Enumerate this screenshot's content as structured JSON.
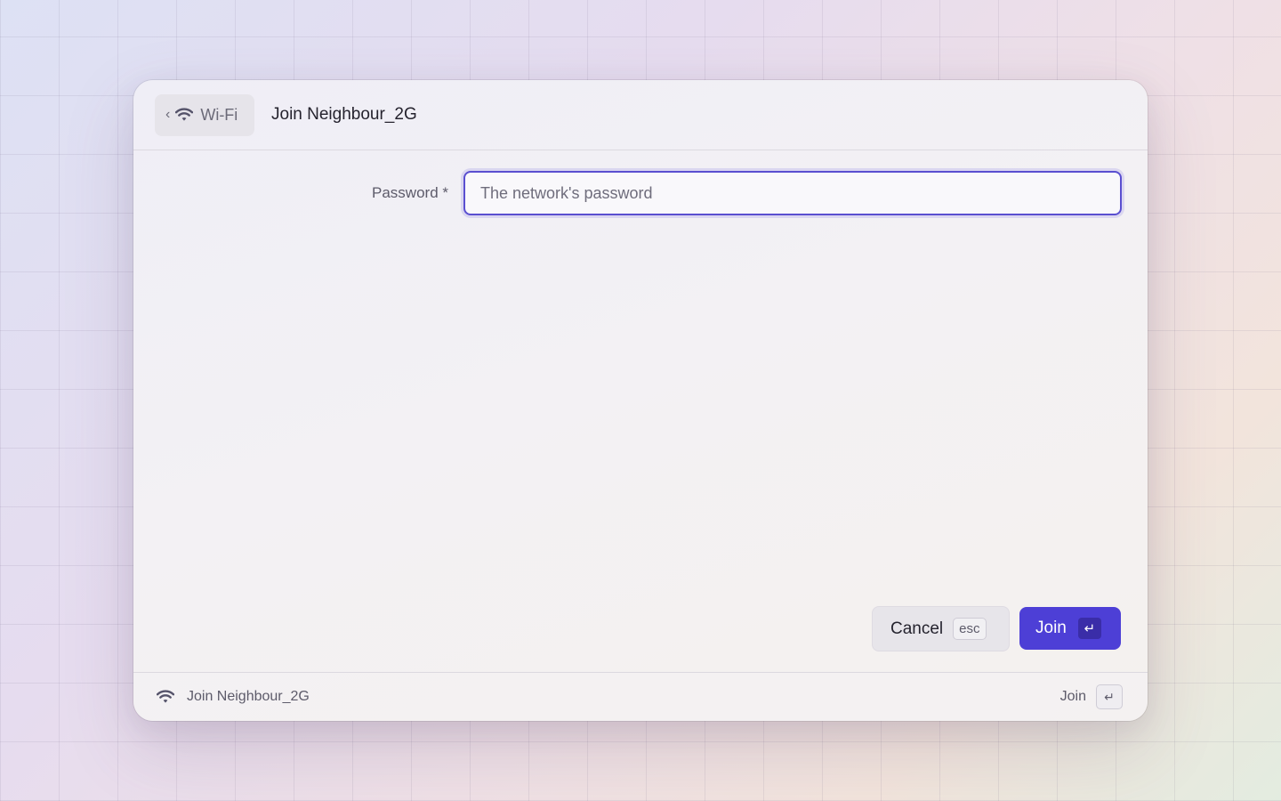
{
  "header": {
    "back_label": "Wi-Fi",
    "back_chevron": "‹",
    "title": "Join Neighbour_2G"
  },
  "form": {
    "password_label": "Password *",
    "password_placeholder": "The network's password",
    "password_value": ""
  },
  "actions": {
    "cancel_label": "Cancel",
    "cancel_shortcut": "esc",
    "join_label": "Join",
    "join_shortcut": "↵"
  },
  "footer": {
    "status_text": "Join Neighbour_2G",
    "action_label": "Join",
    "action_shortcut": "↵"
  },
  "icons": {
    "wifi": "wifi-icon",
    "back": "chevron-left-icon",
    "enter": "return-key-icon"
  },
  "colors": {
    "accent": "#4d3fd6",
    "focus_border": "#5a4fd0"
  }
}
